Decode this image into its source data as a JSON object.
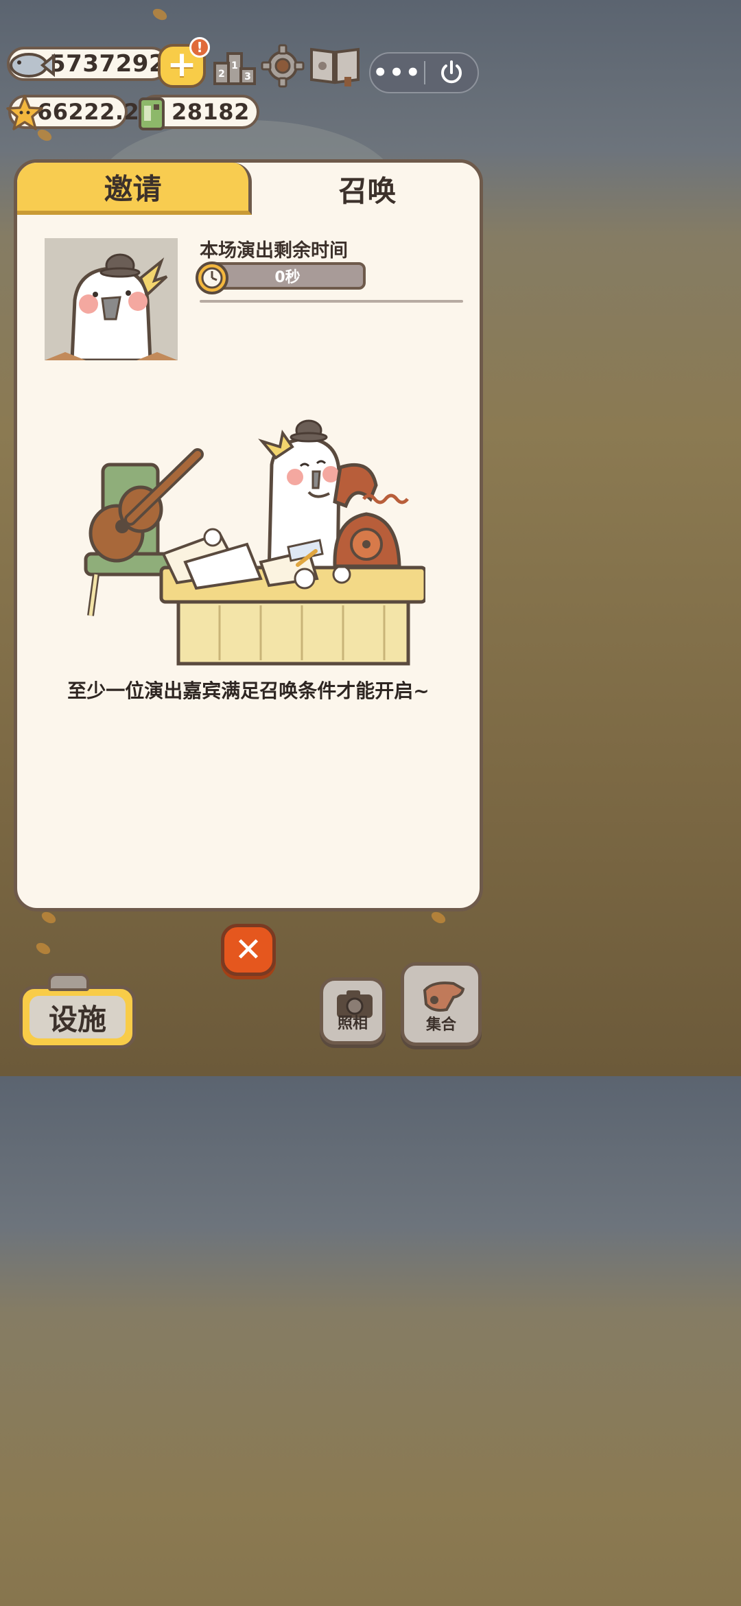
{
  "currency": {
    "fish": "5737292",
    "stars": "66222.2",
    "cans": "28182",
    "add_label": "+",
    "alert_badge": "!"
  },
  "top_menu": {
    "more_label": "•••"
  },
  "panel": {
    "tabs": [
      {
        "label": "邀请",
        "active": false
      },
      {
        "label": "召唤",
        "active": true
      }
    ],
    "remaining_label": "本场演出剩余时间",
    "timer_value": "0秒",
    "hint": "至少一位演出嘉宾满足召唤条件才能开启~"
  },
  "close_label": "✕",
  "bottom": {
    "facility_label": "设施",
    "photo_label": "照相",
    "gather_label": "集合"
  },
  "colors": {
    "accent_yellow": "#f8cc50",
    "panel_bg": "#fcf6ec",
    "border_brown": "#6e5a4b",
    "close_red": "#e5571e"
  }
}
